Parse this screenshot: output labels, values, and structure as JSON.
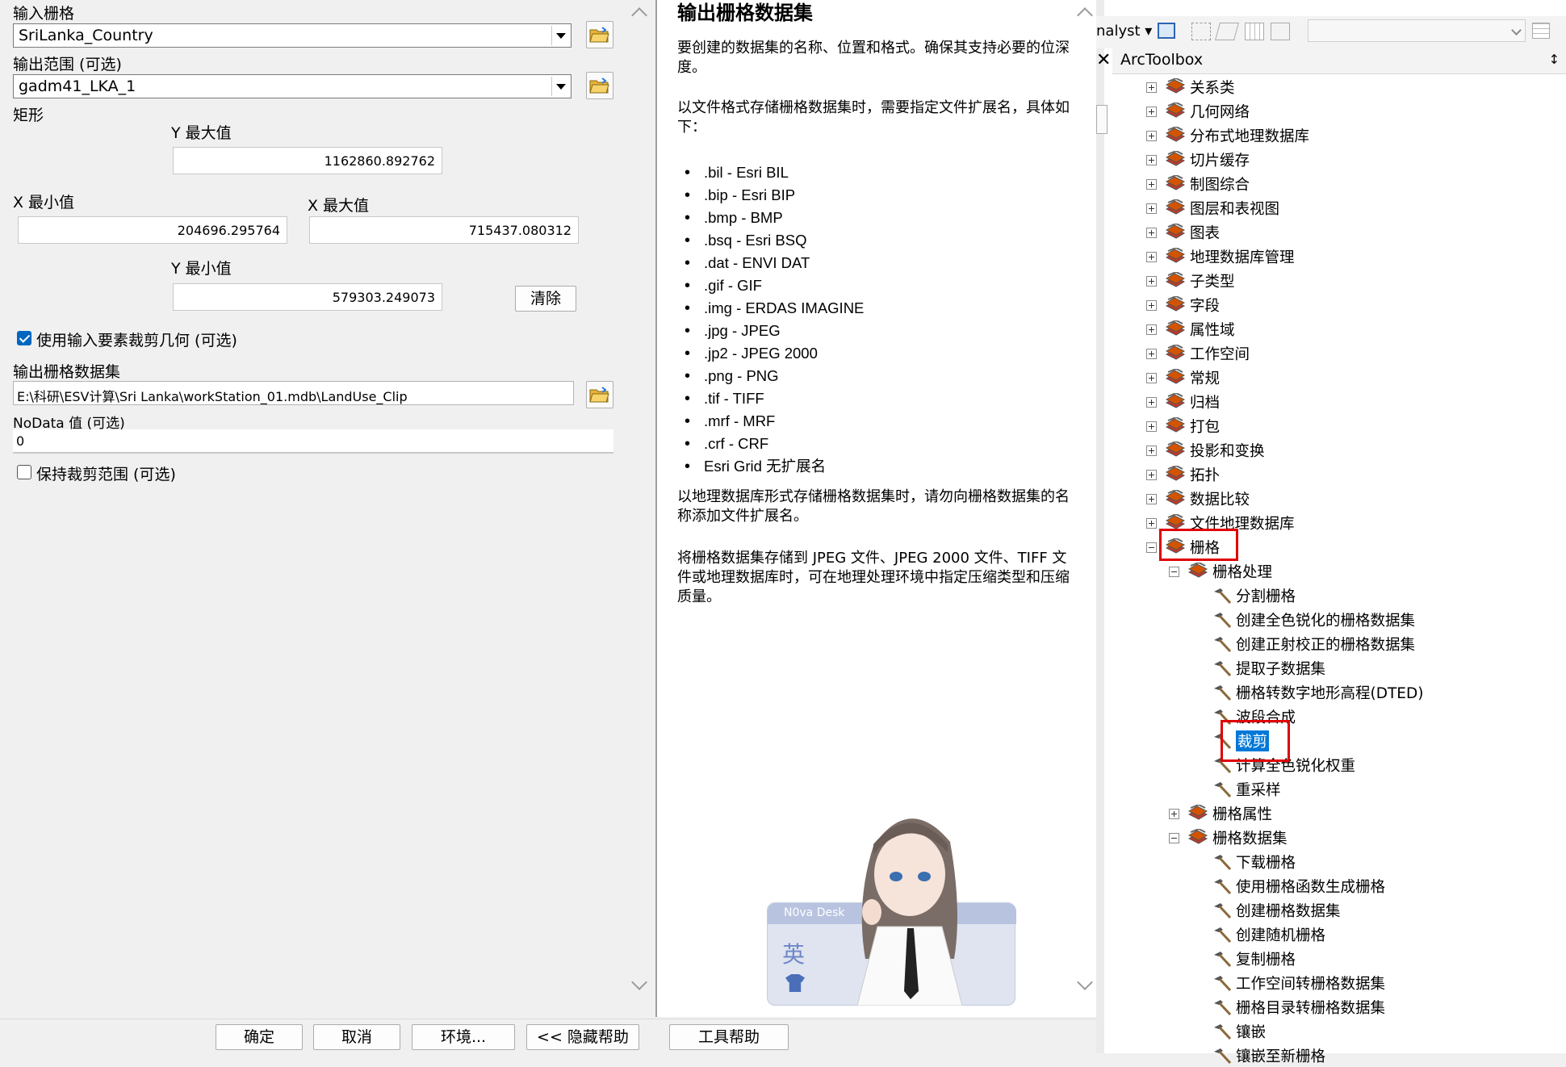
{
  "left": {
    "input_raster_label": "输入栅格",
    "input_raster_value": "SriLanka_Country",
    "output_extent_label": "输出范围 (可选)",
    "output_extent_value": "gadm41_LKA_1",
    "rect_label": "矩形",
    "ymax_label": "Y 最大值",
    "ymax_value": "1162860.892762",
    "xmin_label": "X 最小值",
    "xmin_value": "204696.295764",
    "xmax_label": "X 最大值",
    "xmax_value": "715437.080312",
    "ymin_label": "Y 最小值",
    "ymin_value": "579303.249073",
    "clear_button": "清除",
    "use_geometry_label": "使用输入要素裁剪几何 (可选)",
    "output_raster_label": "输出栅格数据集",
    "output_raster_value": "E:\\科研\\ESV计算\\Sri Lanka\\workStation_01.mdb\\LandUse_Clip",
    "nodata_label": "NoData 值 (可选)",
    "nodata_value": "0",
    "keep_extent_label": "保持裁剪范围 (可选)"
  },
  "buttons": {
    "ok": "确定",
    "cancel": "取消",
    "env": "环境...",
    "hide_help": "<< 隐藏帮助",
    "tool_help": "工具帮助"
  },
  "help": {
    "title": "输出栅格数据集",
    "p1": "要创建的数据集的名称、位置和格式。确保其支持必要的位深度。",
    "p2": "以文件格式存储栅格数据集时，需要指定文件扩展名，具体如下：",
    "formats": [
      ".bil - Esri BIL",
      ".bip - Esri BIP",
      ".bmp - BMP",
      ".bsq - Esri BSQ",
      ".dat - ENVI DAT",
      ".gif - GIF",
      ".img - ERDAS IMAGINE",
      ".jpg - JPEG",
      ".jp2 - JPEG 2000",
      ".png - PNG",
      ".tif - TIFF",
      ".mrf - MRF",
      ".crf - CRF",
      "Esri Grid 无扩展名"
    ],
    "p3": "以地理数据库形式存储栅格数据集时，请勿向栅格数据集的名称添加文件扩展名。",
    "p4": "将栅格数据集存储到 JPEG 文件、JPEG 2000 文件、TIFF 文件或地理数据库时，可在地理处理环境中指定压缩类型和压缩质量。",
    "widget_badge": "N0va Desk",
    "widget_char": "英"
  },
  "toolbox": {
    "toolbar_text": "nalyst ▾",
    "title": "ArcToolbox",
    "pin": "↕",
    "toolsets": [
      "关系类",
      "几何网络",
      "分布式地理数据库",
      "切片缓存",
      "制图综合",
      "图层和表视图",
      "图表",
      "地理数据库管理",
      "子类型",
      "字段",
      "属性域",
      "工作空间",
      "常规",
      "归档",
      "打包",
      "投影和变换",
      "拓扑",
      "数据比较",
      "文件地理数据库",
      "栅格"
    ],
    "raster_processing": "栅格处理",
    "raster_processing_tools": [
      "分割栅格",
      "创建全色锐化的栅格数据集",
      "创建正射校正的栅格数据集",
      "提取子数据集",
      "栅格转数字地形高程(DTED)",
      "波段合成",
      "裁剪",
      "计算全色锐化权重",
      "重采样"
    ],
    "raster_properties": "栅格属性",
    "raster_dataset": "栅格数据集",
    "raster_dataset_tools": [
      "下载栅格",
      "使用栅格函数生成栅格",
      "创建栅格数据集",
      "创建随机栅格",
      "复制栅格",
      "工作空间转栅格数据集",
      "栅格目录转栅格数据集",
      "镶嵌",
      "镶嵌至新栅格"
    ]
  },
  "colors": {
    "highlight_box": "#e00000",
    "selection": "#0078d7",
    "checkbox": "#0067c0"
  }
}
